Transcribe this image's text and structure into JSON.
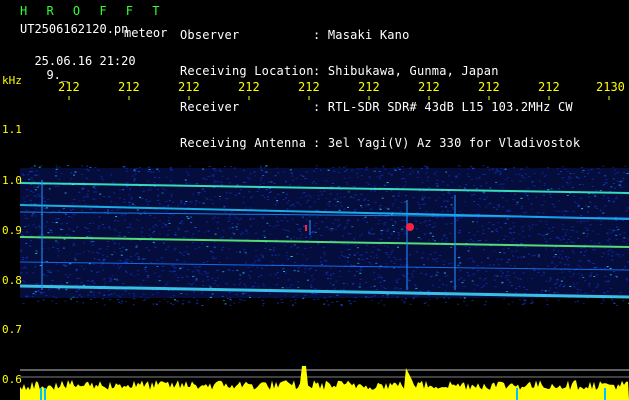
{
  "header": {
    "logo": "H R O F F T",
    "filename": "UT2506162120.pn",
    "mode": "meteor",
    "date": "25.06.16 21:20",
    "frame_no": "9._",
    "field_labels": [
      "Observer",
      "Receiving Location",
      "Receiver",
      "Receiving Antenna"
    ],
    "field_values": [
      ": Masaki Kano",
      ": Shibukawa, Gunma, Japan",
      ": RTL-SDR SDR# 43dB L15 103.2MHz CW",
      ": 3el Yagi(V) Az 330 for Vladivostok"
    ]
  },
  "axis": {
    "unit": "kHz",
    "top_ticks": [
      "212",
      "212",
      "212",
      "212",
      "212",
      "212",
      "212",
      "212",
      "212",
      "2130"
    ],
    "y_ticks": [
      "1.1",
      "1.0",
      "0.9",
      "0.8",
      "0.7",
      "0.6"
    ]
  },
  "colors": {
    "background": "#000000",
    "label": "#ffff00",
    "logo": "#33ff33",
    "text": "#ffffff",
    "gridline": "#c0c0c0",
    "signal_low": "#1030c0",
    "signal_mid": "#20d0ff",
    "signal_high": "#ff2040"
  }
}
